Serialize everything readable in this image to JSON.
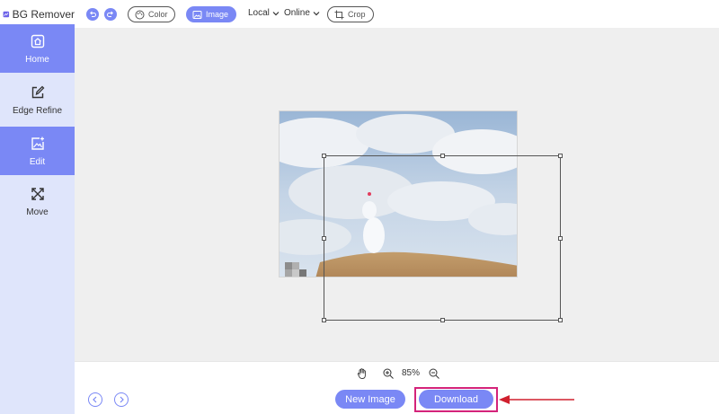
{
  "app": {
    "title": "BG Remover"
  },
  "sidebar": {
    "items": [
      {
        "label": "Home",
        "icon": "home-icon",
        "active": true
      },
      {
        "label": "Edge Refine",
        "icon": "edit-square-icon",
        "active": false
      },
      {
        "label": "Edit",
        "icon": "image-plus-icon",
        "active": true
      },
      {
        "label": "Move",
        "icon": "move-arrows-icon",
        "active": false
      }
    ]
  },
  "toolbar": {
    "color_label": "Color",
    "image_label": "Image",
    "local_label": "Local",
    "online_label": "Online",
    "crop_label": "Crop"
  },
  "zoom": {
    "level": "85%"
  },
  "bottom": {
    "new_image_label": "New Image",
    "download_label": "Download"
  },
  "colors": {
    "accent": "#7a88f5",
    "sidebar_bg": "#dfe5fb",
    "highlight": "#d4237a",
    "arrow": "#d0202e"
  }
}
